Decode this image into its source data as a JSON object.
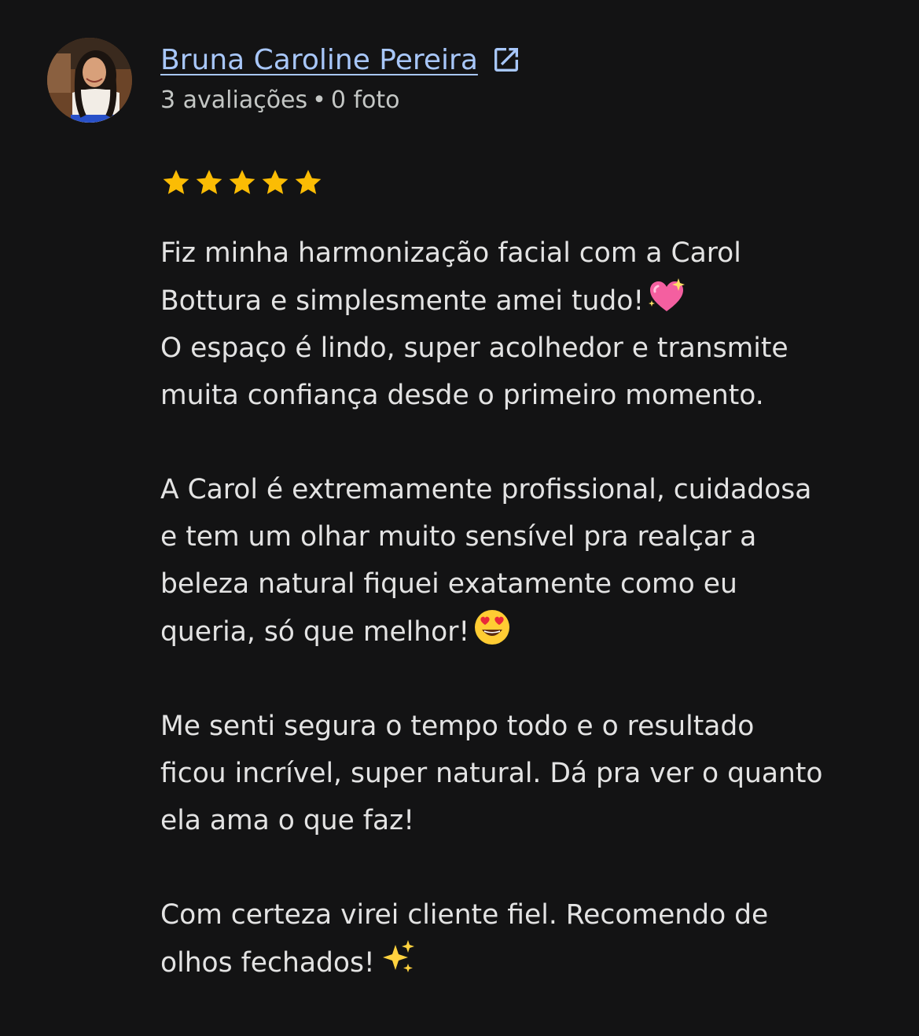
{
  "review": {
    "author": {
      "name": "Bruna Caroline Pereira",
      "avatar_icon": "profile-photo",
      "external_link_icon": "open-in-new-icon"
    },
    "meta": {
      "reviews": "3 avaliações",
      "separator": "•",
      "photos": "0 foto"
    },
    "rating": {
      "value": 5,
      "max": 5,
      "star_color": "#fbbc04"
    },
    "paragraphs": [
      {
        "lines": [
          {
            "text": "Fiz minha harmonização facial com a Carol",
            "emoji": null
          },
          {
            "text": "Bottura e simplesmente amei tudo!",
            "emoji": "sparkling-heart"
          },
          {
            "text": "O espaço é lindo, super acolhedor e transmite",
            "emoji": null
          },
          {
            "text": "muita confiança desde o primeiro momento.",
            "emoji": null
          }
        ]
      },
      {
        "lines": [
          {
            "text": "A Carol é extremamente profissional, cuidadosa",
            "emoji": null
          },
          {
            "text": "e tem um olhar muito sensível pra realçar a",
            "emoji": null
          },
          {
            "text": "beleza natural fiquei exatamente como eu",
            "emoji": null
          },
          {
            "text": "queria, só que melhor!",
            "emoji": "heart-eyes-face"
          }
        ]
      },
      {
        "lines": [
          {
            "text": "Me senti segura o tempo todo e o resultado",
            "emoji": null
          },
          {
            "text": "ficou incrível, super natural. Dá pra ver o quanto",
            "emoji": null
          },
          {
            "text": "ela ama o que faz!",
            "emoji": null
          }
        ]
      },
      {
        "lines": [
          {
            "text": "Com certeza virei cliente fiel. Recomendo de",
            "emoji": null
          },
          {
            "text": "olhos fechados!",
            "emoji": "sparkles"
          }
        ]
      }
    ],
    "colors": {
      "background": "#131314",
      "link": "#a8c7fa",
      "text": "#e3e3e3",
      "secondary_text": "#c4c7c5"
    }
  }
}
